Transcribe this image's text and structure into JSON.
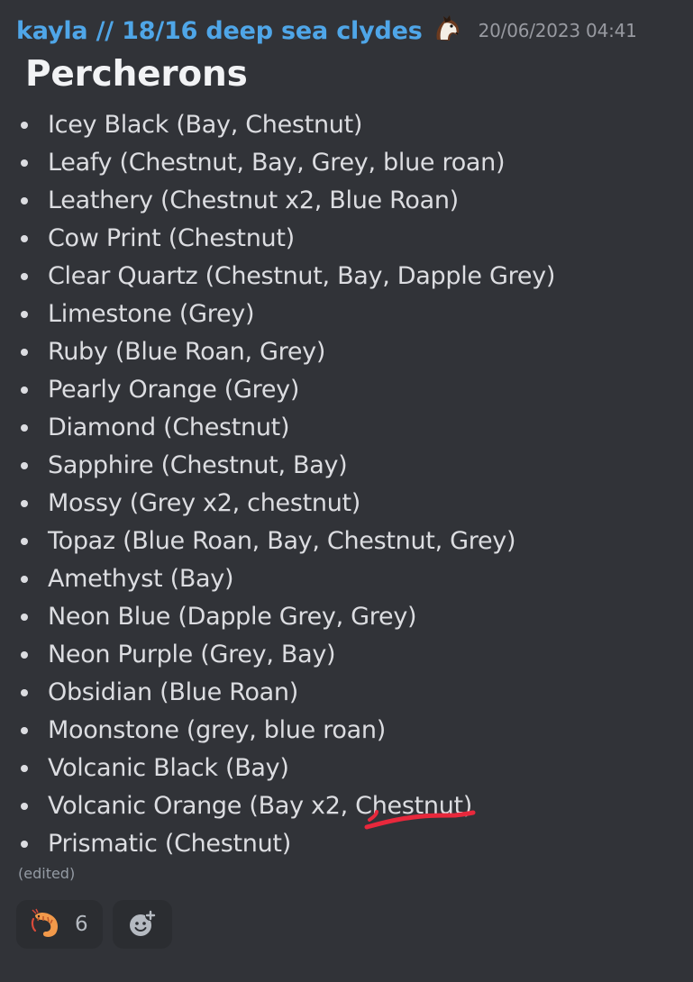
{
  "message": {
    "username": "kayla // 18/16 deep sea clydes",
    "role_icon": "horse-head-icon",
    "timestamp": "20/06/2023 04:41",
    "title": "Percherons",
    "items": [
      "Icey Black (Bay, Chestnut)",
      "Leafy (Chestnut, Bay, Grey, blue roan)",
      "Leathery (Chestnut x2, Blue Roan)",
      "Cow Print (Chestnut)",
      "Clear Quartz (Chestnut, Bay, Dapple Grey)",
      "Limestone (Grey)",
      "Ruby (Blue Roan, Grey)",
      "Pearly Orange (Grey)",
      "Diamond (Chestnut)",
      "Sapphire (Chestnut, Bay)",
      "Mossy (Grey x2, chestnut)",
      "Topaz (Blue Roan, Bay, Chestnut, Grey)",
      "Amethyst (Bay)",
      "Neon Blue (Dapple Grey, Grey)",
      "Neon Purple (Grey, Bay)",
      "Obsidian (Blue Roan)",
      "Moonstone (grey, blue roan)",
      "Volcanic Black (Bay)",
      "Volcanic Orange (Bay x2, Chestnut)",
      "Prismatic (Chestnut)"
    ],
    "edited_label": "(edited)"
  },
  "reactions": [
    {
      "emoji": "shrimp-emoji",
      "count": "6"
    }
  ],
  "add_reaction_icon": "add-reaction-icon",
  "colors": {
    "background": "#313338",
    "username": "#4fa6e8",
    "timestamp": "#989aa1",
    "text": "#dcdde1",
    "reaction_bg": "#2b2d31",
    "annotation": "#e8283c"
  }
}
